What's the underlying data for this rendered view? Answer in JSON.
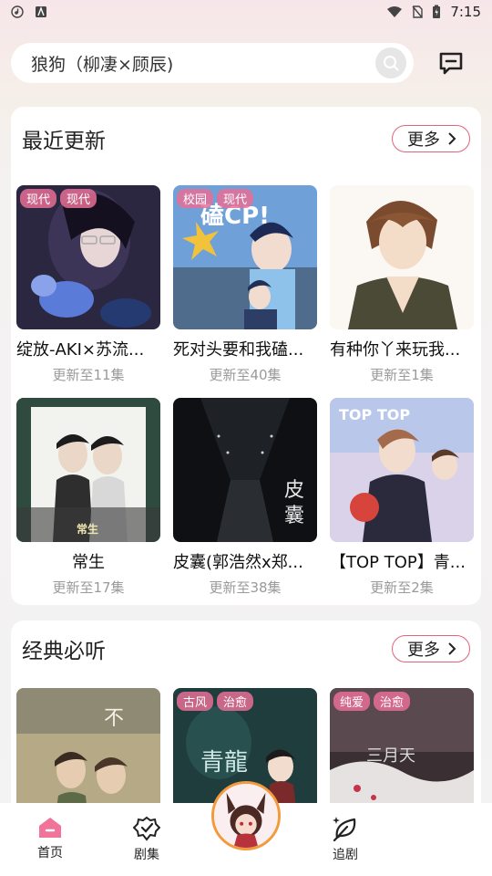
{
  "status_bar": {
    "time": "7:15"
  },
  "search": {
    "value": "狼狗（柳凄×顾辰)"
  },
  "sections": [
    {
      "title": "最近更新",
      "more_label": "更多",
      "items": [
        {
          "title": "绽放-AKI×苏流...",
          "subtitle": "更新至11集",
          "tags": [
            "现代",
            "现代"
          ]
        },
        {
          "title": "死对头要和我磕...",
          "subtitle": "更新至40集",
          "tags": [
            "校园",
            "现代"
          ]
        },
        {
          "title": "有种你丫来玩我...",
          "subtitle": "更新至1集",
          "tags": []
        },
        {
          "title": "常生",
          "subtitle": "更新至17集",
          "tags": []
        },
        {
          "title": "皮囊(郭浩然x郑...",
          "subtitle": "更新至38集",
          "tags": []
        },
        {
          "title": "【TOP TOP】青...",
          "subtitle": "更新至2集",
          "tags": []
        }
      ]
    },
    {
      "title": "经典必听",
      "more_label": "更多",
      "items": [
        {
          "tags": []
        },
        {
          "tags": [
            "古风",
            "治愈"
          ]
        },
        {
          "tags": [
            "纯爱",
            "治愈"
          ]
        }
      ]
    }
  ],
  "bottom_nav": [
    {
      "label": "首页",
      "icon": "home-icon",
      "active": true
    },
    {
      "label": "剧集",
      "icon": "badge-icon"
    },
    {
      "label": "追剧",
      "icon": "leaf-icon"
    }
  ],
  "colors": {
    "accent": "#e0657d",
    "tag_bg": "#e86e96",
    "center_ring": "#f39a3c"
  }
}
